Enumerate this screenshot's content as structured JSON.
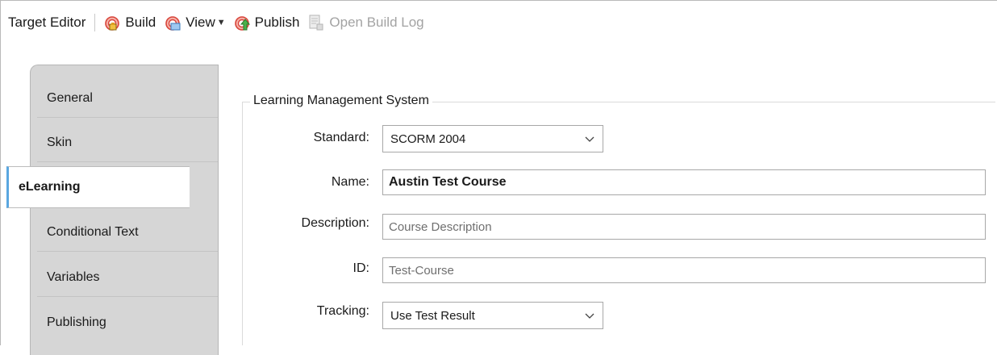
{
  "toolbar": {
    "title": "Target Editor",
    "build_label": "Build",
    "view_label": "View",
    "publish_label": "Publish",
    "open_build_log_label": "Open Build Log",
    "icons": [
      "build-icon",
      "view-icon",
      "publish-icon",
      "open-build-log-icon"
    ]
  },
  "tabs": [
    {
      "label": "General",
      "active": false
    },
    {
      "label": "Skin",
      "active": false
    },
    {
      "label": "eLearning",
      "active": true
    },
    {
      "label": "Conditional Text",
      "active": false
    },
    {
      "label": "Variables",
      "active": false
    },
    {
      "label": "Publishing",
      "active": false
    }
  ],
  "lms": {
    "group_title": "Learning Management System",
    "standard": {
      "label": "Standard:",
      "value": "SCORM 2004"
    },
    "name": {
      "label": "Name:",
      "value": "Austin Test Course"
    },
    "description": {
      "label": "Description:",
      "placeholder": "Course Description"
    },
    "id": {
      "label": "ID:",
      "placeholder": "Test-Course"
    },
    "tracking": {
      "label": "Tracking:",
      "value": "Use Test Result"
    }
  },
  "colors": {
    "accent_tab_border": "#5aa7e0",
    "tab_panel_bg": "#d6d6d6"
  }
}
